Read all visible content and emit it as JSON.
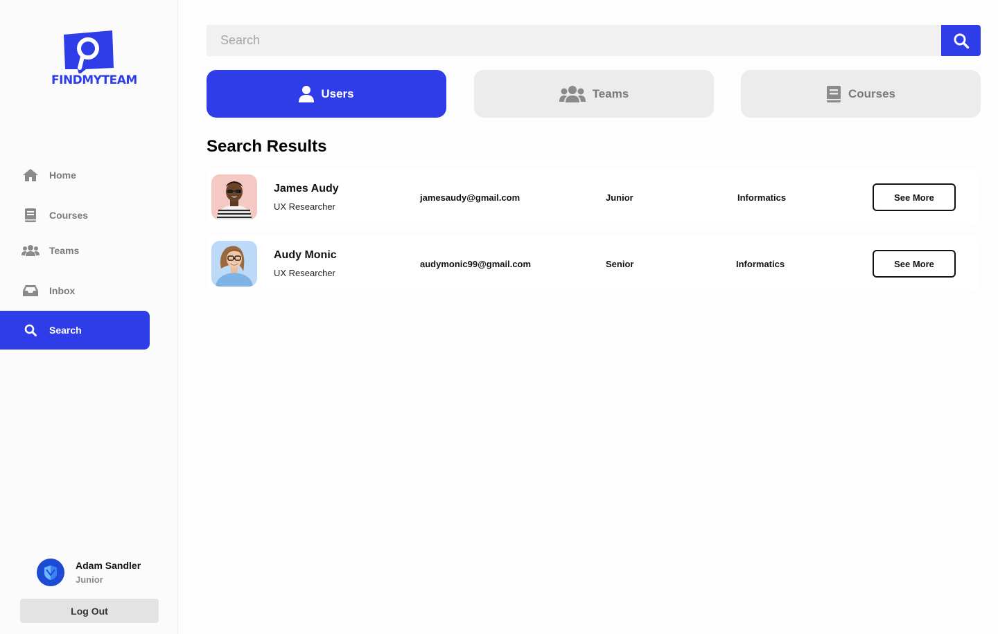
{
  "brand": {
    "logo_text": "FINDMYTEAM",
    "accent_color": "#2f3de8"
  },
  "sidebar": {
    "items": [
      {
        "label": "Home",
        "icon": "home-icon"
      },
      {
        "label": "Courses",
        "icon": "book-icon"
      },
      {
        "label": "Teams",
        "icon": "users-group-icon"
      },
      {
        "label": "Inbox",
        "icon": "inbox-icon"
      },
      {
        "label": "Search",
        "icon": "search-icon",
        "active": true
      }
    ],
    "profile": {
      "name": "Adam Sandler",
      "role": "Junior"
    },
    "logout_label": "Log Out"
  },
  "search": {
    "placeholder": "Search",
    "value": ""
  },
  "tabs": [
    {
      "label": "Users",
      "icon": "user-icon",
      "active": true
    },
    {
      "label": "Teams",
      "icon": "users-group-icon",
      "active": false
    },
    {
      "label": "Courses",
      "icon": "book-icon",
      "active": false
    }
  ],
  "results": {
    "title": "Search Results",
    "rows": [
      {
        "name": "James Audy",
        "role": "UX Researcher",
        "email": "jamesaudy@gmail.com",
        "level": "Junior",
        "department": "Informatics",
        "action": "See More"
      },
      {
        "name": "Audy Monic",
        "role": "UX Researcher",
        "email": "audymonic99@gmail.com",
        "level": "Senior",
        "department": "Informatics",
        "action": "See More"
      }
    ]
  }
}
